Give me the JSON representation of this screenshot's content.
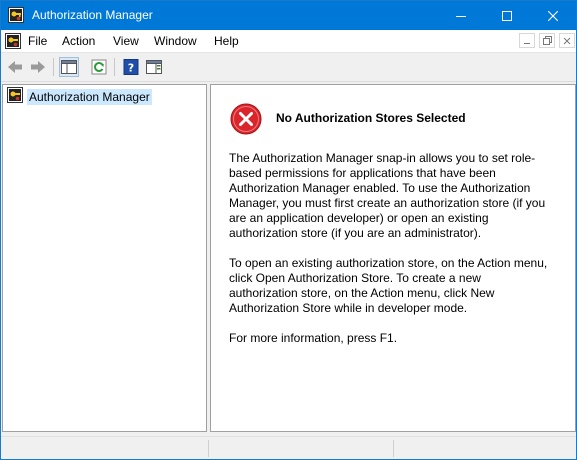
{
  "window": {
    "title": "Authorization Manager",
    "accent_color": "#0078d7",
    "caption_buttons": [
      "minimize-icon",
      "maximize-icon",
      "close-icon"
    ]
  },
  "menu": {
    "items": [
      "File",
      "Action",
      "View",
      "Window",
      "Help"
    ]
  },
  "toolbar": {
    "buttons": [
      "back-arrow-icon",
      "forward-arrow-icon",
      "show-hide-console-tree-icon",
      "refresh-icon",
      "help-icon",
      "show-hide-action-pane-icon"
    ]
  },
  "tree": {
    "root_label": "Authorization Manager",
    "selected_color": "#cce8ff"
  },
  "content": {
    "title": "No Authorization Stores Selected",
    "icon": "error-icon",
    "paragraph1": "The Authorization Manager snap-in allows you to set role-based permissions for applications that have been Authorization Manager enabled. To use the Authorization Manager, you must first create an authorization store (if you are an application developer) or open an existing authorization store (if you are an administrator).",
    "paragraph2": "To open an existing authorization store, on the Action menu, click Open Authorization Store. To create a new authorization store, on the Action menu, click New Authorization Store while in developer mode.",
    "paragraph3": "For more information, press F1."
  }
}
